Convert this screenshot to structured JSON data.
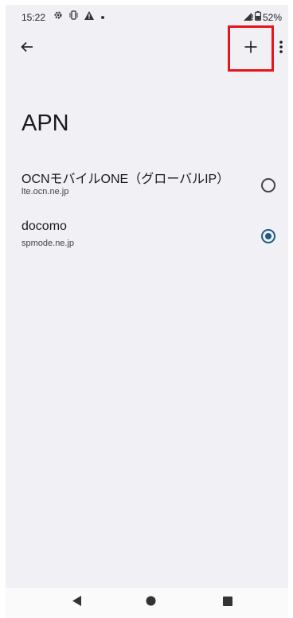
{
  "status_bar": {
    "time": "15:22",
    "battery": "52%",
    "left_icons": [
      "settings-icon",
      "vibrate-icon",
      "warning-icon",
      "dot-icon"
    ],
    "right_icons": [
      "signal-icon",
      "battery-icon"
    ]
  },
  "toolbar": {
    "back_icon": "arrow-left-icon",
    "add_label": "+",
    "more_icon": "more-vert-icon"
  },
  "page": {
    "title": "APN"
  },
  "apn_list": [
    {
      "name": "OCNモバイルONE（グローバルIP）",
      "apn": "lte.ocn.ne.jp",
      "selected": false
    },
    {
      "name": "docomo",
      "apn": "spmode.ne.jp",
      "selected": true
    }
  ],
  "nav_bar": {
    "icons": [
      "back-triangle-icon",
      "home-circle-icon",
      "recents-square-icon"
    ]
  },
  "colors": {
    "background": "#f0f0f5",
    "accent": "#1f5a85",
    "highlight_box": "#e8141c"
  }
}
